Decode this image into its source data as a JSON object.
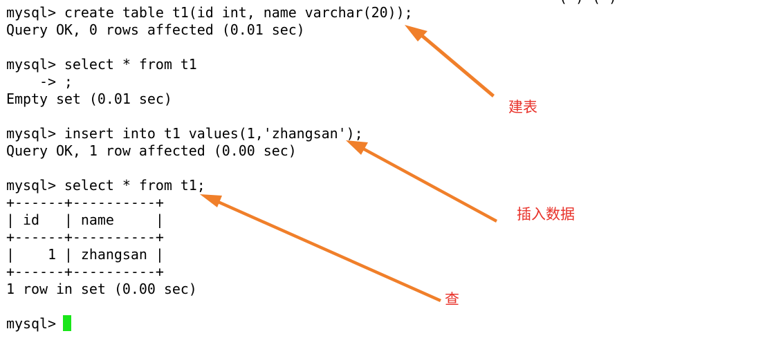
{
  "terminal": {
    "partial_top_line": "( ) ( )",
    "lines": [
      "mysql> create table t1(id int, name varchar(20));",
      "Query OK, 0 rows affected (0.01 sec)",
      "",
      "mysql> select * from t1",
      "    -> ;",
      "Empty set (0.01 sec)",
      "",
      "mysql> insert into t1 values(1,'zhangsan');",
      "Query OK, 1 row affected (0.00 sec)",
      "",
      "mysql> select * from t1;",
      "+------+----------+",
      "| id   | name     |",
      "+------+----------+",
      "|    1 | zhangsan |",
      "+------+----------+",
      "1 row in set (0.00 sec)",
      "",
      "mysql> "
    ],
    "cursor_color": "#19e619"
  },
  "annotations": [
    {
      "label": "建表",
      "color": "#e8322a"
    },
    {
      "label": "插入数据",
      "color": "#e8322a"
    },
    {
      "label": "查",
      "color": "#e8322a"
    }
  ]
}
